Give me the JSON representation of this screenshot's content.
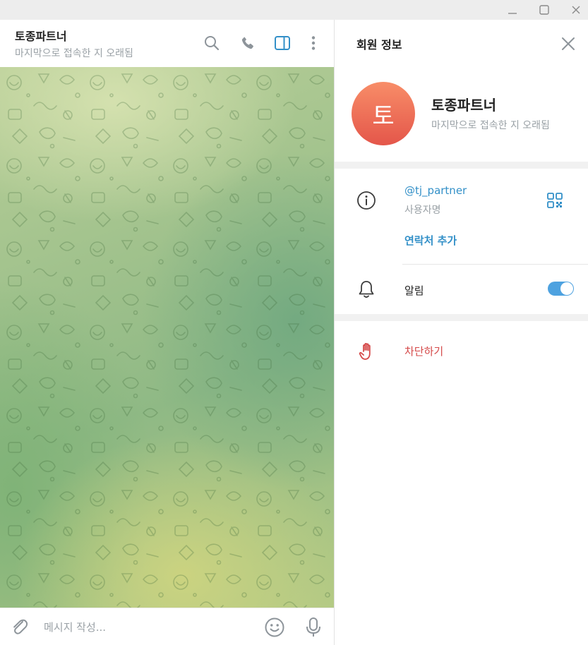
{
  "colors": {
    "accent": "#3390c8",
    "toggle_on": "#4ea2e0",
    "danger": "#d54a4a",
    "muted_text": "#9aa1a6",
    "avatar_gradient": [
      "#f88d68",
      "#e4564a"
    ]
  },
  "window_controls": {
    "minimize_icon": "minimize-icon",
    "maximize_icon": "maximize-icon",
    "close_icon": "close-icon"
  },
  "chat": {
    "title": "토종파트너",
    "status": "마지막으로 접속한 지 오래됨",
    "header_icons": [
      "search-icon",
      "phone-icon",
      "sidebar-toggle-icon",
      "more-vertical-icon"
    ],
    "composer": {
      "placeholder": "메시지 작성...",
      "value": "",
      "icons": [
        "paperclip-icon",
        "emoji-icon",
        "microphone-icon"
      ]
    }
  },
  "panel": {
    "title": "회원 정보",
    "profile": {
      "avatar_letter": "토",
      "name": "토종파트너",
      "status": "마지막으로 접속한 지 오래됨"
    },
    "info": {
      "username": "@tj_partner",
      "username_label": "사용자명",
      "add_contact": "연락처 추가"
    },
    "notifications": {
      "label": "알림",
      "enabled": true
    },
    "block": {
      "label": "차단하기"
    }
  }
}
